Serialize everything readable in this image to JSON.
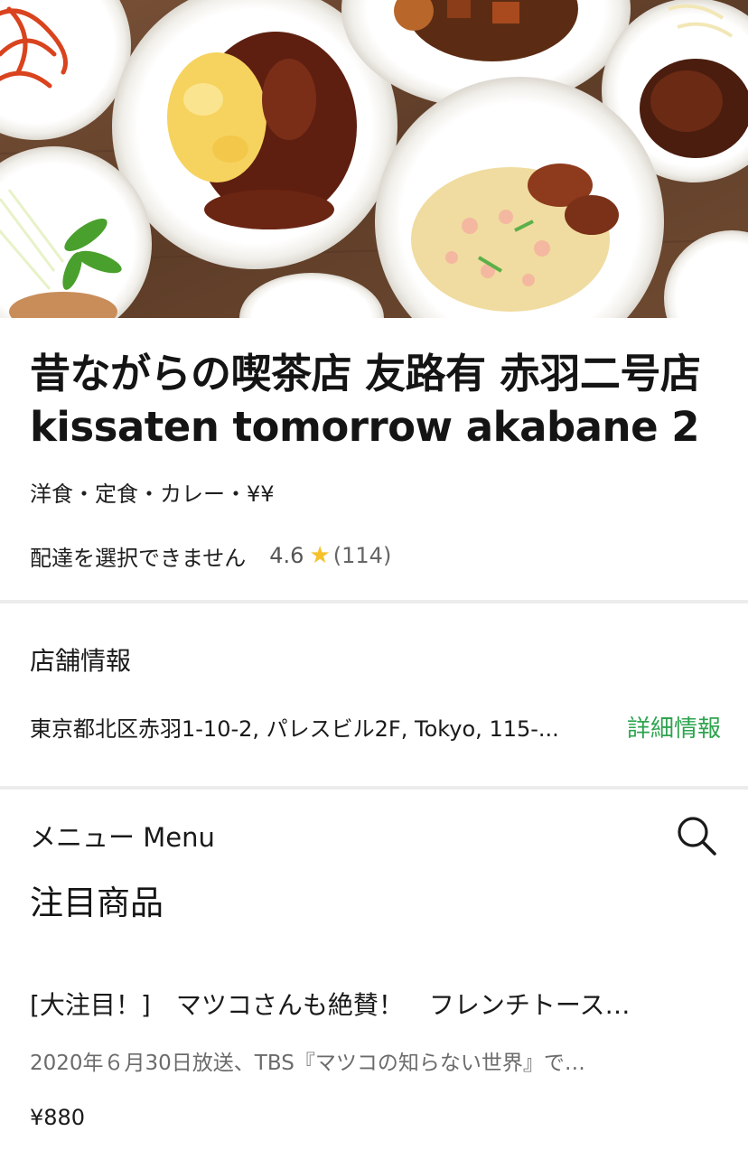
{
  "store": {
    "title": "昔ながらの喫茶店 友路有 赤羽二号店 kissaten tomorrow akabane 2",
    "categories": "洋食・定食・カレー・¥¥",
    "delivery_status": "配達を選択できません",
    "rating": "4.6",
    "review_count": "(114)"
  },
  "info": {
    "heading": "店舗情報",
    "address": "東京都北区赤羽1-10-2, パレスビル2F, Tokyo, 115-...",
    "details_link": "詳細情報"
  },
  "menu": {
    "title": "メニュー Menu",
    "featured_heading": "注目商品",
    "items": [
      {
        "name": "[大注目！]　マツコさんも絶賛！　フレンチトース…",
        "description": "2020年６月30日放送、TBS『マツコの知らない世界』で…",
        "price": "¥880"
      }
    ]
  },
  "icons": {
    "rating_star": "star-icon",
    "search": "search-icon"
  },
  "colors": {
    "accent_link": "#2ea44f",
    "star": "#f6c12a",
    "divider": "#ececec"
  }
}
